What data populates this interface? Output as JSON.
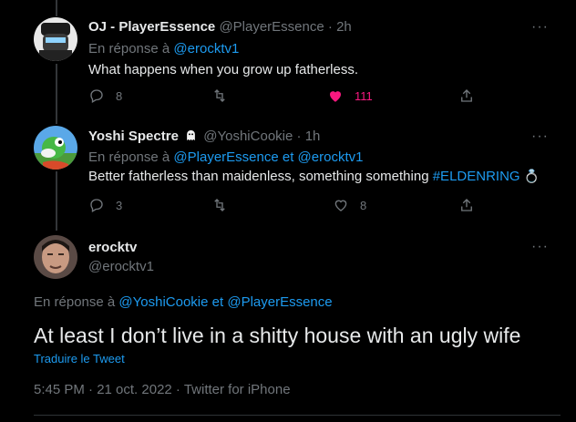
{
  "tweets": [
    {
      "name": "OJ - PlayerEssence",
      "handle": "@PlayerEssence",
      "sep": "·",
      "time": "2h",
      "replying_prefix": "En réponse à",
      "replying_to": [
        "@erocktv1"
      ],
      "text": "What happens when you grow up fatherless.",
      "replies": "8",
      "retweets": "",
      "likes": "111",
      "liked": true
    },
    {
      "name": "Yoshi Spectre",
      "name_emoji": "ghost-icon",
      "handle": "@YoshiCookie",
      "sep": "·",
      "time": "1h",
      "replying_prefix": "En réponse à",
      "replying_to": [
        "@PlayerEssence",
        "et",
        "@erocktv1"
      ],
      "text": "Better fatherless than maidenless, something something",
      "hashtag": "#ELDENRING",
      "hashtag_emoji": "💍",
      "replies": "3",
      "retweets": "",
      "likes": "8",
      "liked": false
    }
  ],
  "main_tweet": {
    "name": "erocktv",
    "handle": "@erocktv1",
    "replying_prefix": "En réponse à",
    "replying_to": [
      "@YoshiCookie",
      "et",
      "@PlayerEssence"
    ],
    "text": "At least I don’t live in a shitty house with an ugly wife",
    "translate_label": "Traduire le Tweet",
    "timestamp": "5:45 PM · 21 oct. 2022 · Twitter for iPhone"
  },
  "more_label": "···",
  "colors": {
    "background": "#000000",
    "text": "#e7e9ea",
    "muted": "#71767b",
    "link": "#1d9bf0",
    "like": "#f91880",
    "line": "#333639"
  }
}
